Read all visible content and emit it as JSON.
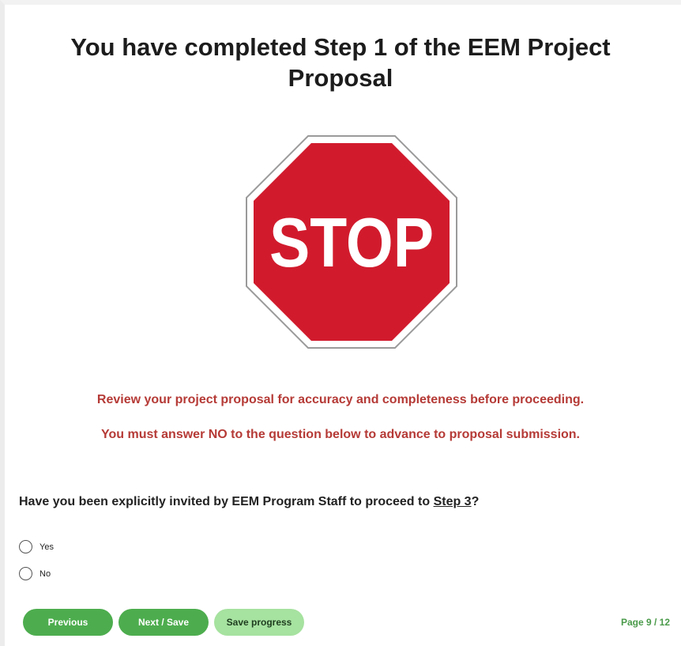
{
  "title": {
    "line1": "You have completed Step 1 of the EEM Project",
    "line2": "Proposal"
  },
  "image": {
    "icon": "stop-sign-icon",
    "text": "STOP",
    "colors": {
      "fill": "#d11b2d",
      "border": "#ffffff",
      "outline": "#9a9a9a",
      "text": "#ffffff"
    }
  },
  "notices": [
    "Review your project proposal for accuracy and completeness before proceeding.",
    "You must answer NO to the question below to advance to proposal submission."
  ],
  "question": {
    "text_before": "Have you been explicitly invited by EEM Program Staff to proceed to ",
    "link_text": "Step 3",
    "text_after": "?"
  },
  "options": [
    {
      "label": "Yes",
      "selected": false
    },
    {
      "label": "No",
      "selected": false
    }
  ],
  "buttons": {
    "previous": "Previous",
    "next_save": "Next / Save",
    "save_progress": "Save progress"
  },
  "pagination": {
    "label": "Page 9 / 12"
  },
  "colors": {
    "accent": "#4dad4e",
    "accent_light": "#a6e2a0",
    "notice": "#b53a36"
  }
}
